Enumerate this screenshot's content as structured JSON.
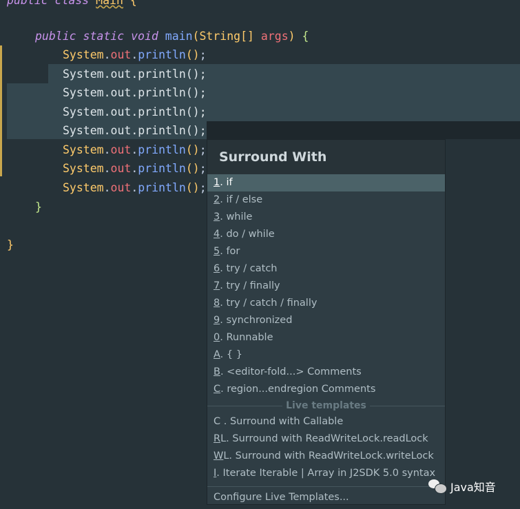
{
  "editor": {
    "class_line": {
      "kw1": "public",
      "kw2": "class",
      "name": "Main",
      "brace": "{"
    },
    "main_sig": {
      "kw1": "public",
      "kw2": "static",
      "kw3": "void",
      "name": "main",
      "open": "(",
      "type": "String[]",
      "arg": "args",
      "close": ")",
      "brace": "{"
    },
    "stmt": {
      "cls": "System",
      "dot1": ".",
      "fld": "out",
      "dot2": ".",
      "fn": "println",
      "paren": "()",
      "semi": ";"
    },
    "close_method": "}",
    "close_class": "}"
  },
  "popup": {
    "title": "Surround With",
    "items": [
      {
        "key": "1",
        "label": ". if"
      },
      {
        "key": "2",
        "label": ". if / else"
      },
      {
        "key": "3",
        "label": ". while"
      },
      {
        "key": "4",
        "label": ". do / while"
      },
      {
        "key": "5",
        "label": ". for"
      },
      {
        "key": "6",
        "label": ". try / catch"
      },
      {
        "key": "7",
        "label": ". try / finally"
      },
      {
        "key": "8",
        "label": ". try / catch / finally"
      },
      {
        "key": "9",
        "label": ". synchronized"
      },
      {
        "key": "0",
        "label": ". Runnable"
      },
      {
        "key": "A",
        "label": ". { }"
      },
      {
        "key": "B",
        "label": ". <editor-fold...> Comments"
      },
      {
        "key": "C",
        "label": ". region...endregion Comments"
      }
    ],
    "section": "Live templates",
    "templates": [
      {
        "key": "",
        "label": "C . Surround with Callable"
      },
      {
        "key": "R",
        "label": "L. Surround with ReadWriteLock.readLock"
      },
      {
        "key": "W",
        "label": "L. Surround with ReadWriteLock.writeLock"
      },
      {
        "key": "I",
        "label": ". Iterate Iterable | Array in J2SDK 5.0 syntax"
      }
    ],
    "configure": "Configure Live Templates..."
  },
  "watermark": "Java知音"
}
